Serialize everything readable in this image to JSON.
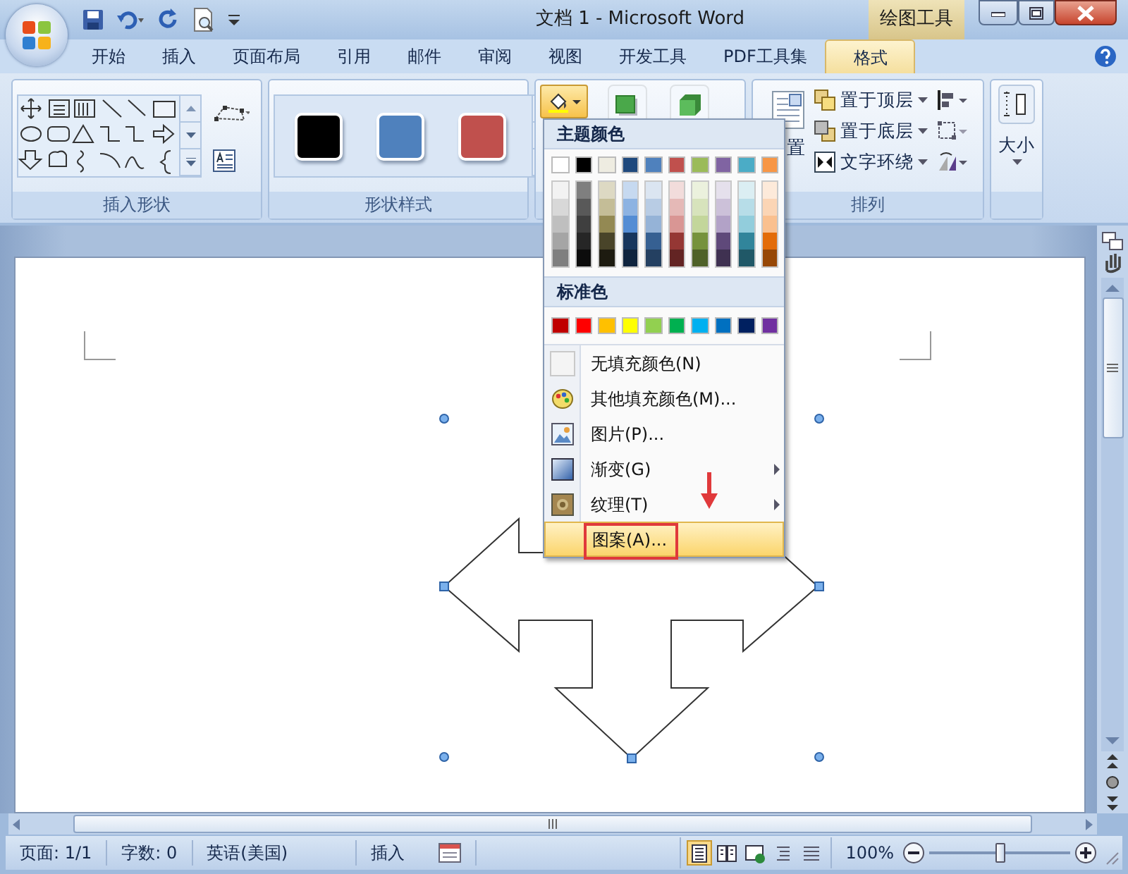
{
  "window": {
    "title": "文档 1 - Microsoft Word",
    "context_tab": "绘图工具"
  },
  "tabs": [
    {
      "label": "开始",
      "selected": false
    },
    {
      "label": "插入",
      "selected": false
    },
    {
      "label": "页面布局",
      "selected": false
    },
    {
      "label": "引用",
      "selected": false
    },
    {
      "label": "邮件",
      "selected": false
    },
    {
      "label": "审阅",
      "selected": false
    },
    {
      "label": "视图",
      "selected": false
    },
    {
      "label": "开发工具",
      "selected": false
    },
    {
      "label": "PDF工具集",
      "selected": false
    },
    {
      "label": "格式",
      "selected": true
    }
  ],
  "ribbon": {
    "insert_shapes": {
      "label": "插入形状"
    },
    "shape_styles": {
      "label": "形状样式",
      "styles": [
        {
          "color": "#000000"
        },
        {
          "color": "#4f81bd"
        },
        {
          "color": "#c0504d"
        }
      ]
    },
    "arrange": {
      "label": "排列",
      "position_button": "置",
      "commands": [
        {
          "label": "置于顶层"
        },
        {
          "label": "置于底层"
        },
        {
          "label": "文字环绕"
        }
      ]
    },
    "size": {
      "button": "大小"
    }
  },
  "fill_menu": {
    "theme_heading": "主题颜色",
    "theme_colors": [
      {
        "color": "#ffffff",
        "shades": [
          {
            "color": "#f2f2f2"
          },
          {
            "color": "#d8d8d8"
          },
          {
            "color": "#bfbfbf"
          },
          {
            "color": "#a5a5a5"
          },
          {
            "color": "#7f7f7f"
          }
        ]
      },
      {
        "color": "#000000",
        "shades": [
          {
            "color": "#7f7f7f"
          },
          {
            "color": "#595959"
          },
          {
            "color": "#3f3f3f"
          },
          {
            "color": "#262626"
          },
          {
            "color": "#0c0c0c"
          }
        ]
      },
      {
        "color": "#eeece1",
        "shades": [
          {
            "color": "#ddd9c3"
          },
          {
            "color": "#c4bd97"
          },
          {
            "color": "#938953"
          },
          {
            "color": "#494429"
          },
          {
            "color": "#1d1b10"
          }
        ]
      },
      {
        "color": "#1f497d",
        "shades": [
          {
            "color": "#c6d9f0"
          },
          {
            "color": "#8db3e2"
          },
          {
            "color": "#548dd4"
          },
          {
            "color": "#17365d"
          },
          {
            "color": "#0f243e"
          }
        ]
      },
      {
        "color": "#4f81bd",
        "shades": [
          {
            "color": "#dbe5f1"
          },
          {
            "color": "#b8cce4"
          },
          {
            "color": "#95b3d7"
          },
          {
            "color": "#366092"
          },
          {
            "color": "#244061"
          }
        ]
      },
      {
        "color": "#c0504d",
        "shades": [
          {
            "color": "#f2dcdb"
          },
          {
            "color": "#e5b9b7"
          },
          {
            "color": "#d99694"
          },
          {
            "color": "#953734"
          },
          {
            "color": "#632423"
          }
        ]
      },
      {
        "color": "#9bbb59",
        "shades": [
          {
            "color": "#ebf1dd"
          },
          {
            "color": "#d7e3bc"
          },
          {
            "color": "#c3d69b"
          },
          {
            "color": "#76923c"
          },
          {
            "color": "#4f6128"
          }
        ]
      },
      {
        "color": "#8064a2",
        "shades": [
          {
            "color": "#e5e0ec"
          },
          {
            "color": "#ccc1d9"
          },
          {
            "color": "#b2a2c7"
          },
          {
            "color": "#5f497a"
          },
          {
            "color": "#3f3151"
          }
        ]
      },
      {
        "color": "#4bacc6",
        "shades": [
          {
            "color": "#dbeef3"
          },
          {
            "color": "#b7dde8"
          },
          {
            "color": "#92cddc"
          },
          {
            "color": "#31859b"
          },
          {
            "color": "#205867"
          }
        ]
      },
      {
        "color": "#f79646",
        "shades": [
          {
            "color": "#fdeada"
          },
          {
            "color": "#fbd5b5"
          },
          {
            "color": "#fac08f"
          },
          {
            "color": "#e36c09"
          },
          {
            "color": "#974806"
          }
        ]
      }
    ],
    "standard_heading": "标准色",
    "standard_colors": [
      {
        "color": "#c00000"
      },
      {
        "color": "#ff0000"
      },
      {
        "color": "#ffc000"
      },
      {
        "color": "#ffff00"
      },
      {
        "color": "#92d050"
      },
      {
        "color": "#00b050"
      },
      {
        "color": "#00b0f0"
      },
      {
        "color": "#0070c0"
      },
      {
        "color": "#002060"
      },
      {
        "color": "#7030a0"
      }
    ],
    "items": [
      {
        "kind": "no-fill",
        "label": "无填充颜色(N)",
        "submenu": false,
        "selected": false
      },
      {
        "kind": "more-colors",
        "label": "其他填充颜色(M)...",
        "submenu": false,
        "selected": false
      },
      {
        "kind": "picture",
        "label": "图片(P)...",
        "submenu": false,
        "selected": false
      },
      {
        "kind": "gradient",
        "label": "渐变(G)",
        "submenu": true,
        "selected": false
      },
      {
        "kind": "texture",
        "label": "纹理(T)",
        "submenu": true,
        "selected": false
      },
      {
        "kind": "pattern",
        "label": "图案(A)...",
        "submenu": false,
        "selected": true
      }
    ]
  },
  "status_bar": {
    "page": "页面: 1/1",
    "words": "字数: 0",
    "language": "英语(美国)",
    "mode": "插入",
    "views": [
      {
        "kind": "print-layout",
        "selected": true
      },
      {
        "kind": "full-screen",
        "selected": false
      },
      {
        "kind": "web",
        "selected": false
      },
      {
        "kind": "outline",
        "selected": false
      },
      {
        "kind": "draft",
        "selected": false
      }
    ],
    "zoom": "100%",
    "zoom_slider": {
      "level": 0.5
    }
  }
}
